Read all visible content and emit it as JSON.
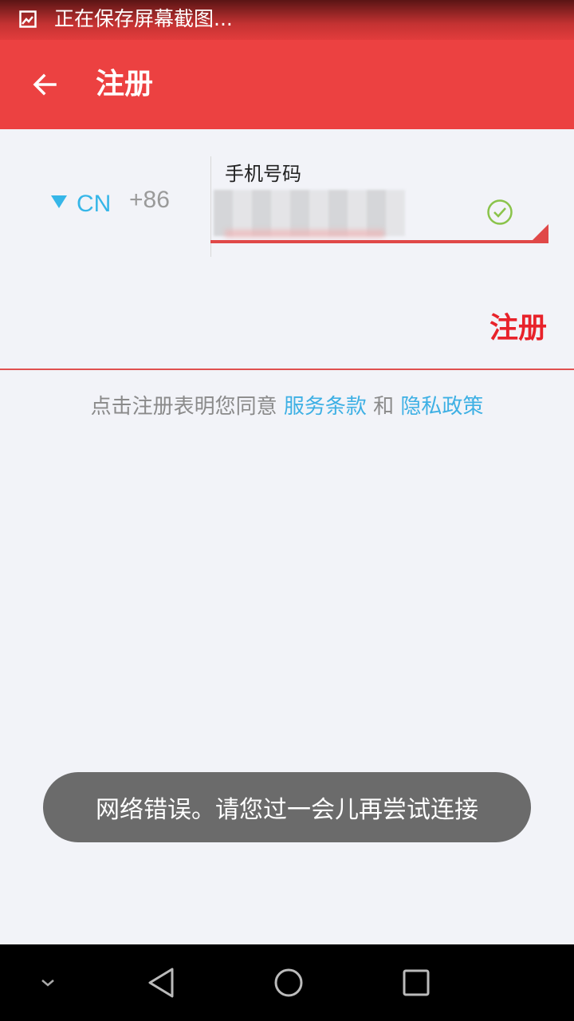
{
  "status_bar": {
    "notification_text": "正在保存屏幕截图..."
  },
  "app_bar": {
    "title": "注册"
  },
  "form": {
    "country_code": "CN",
    "dial_code": "+86",
    "phone_label": "手机号码",
    "phone_value": ""
  },
  "actions": {
    "register_label": "注册"
  },
  "agreement": {
    "prefix": "点击注册表明您同意",
    "terms_link": "服务条款",
    "conjunction": "和",
    "privacy_link": "隐私政策"
  },
  "toast": {
    "message": "网络错误。请您过一会儿再尝试连接"
  },
  "colors": {
    "primary": "#ec4141",
    "link": "#3eb0e4",
    "accent_text": "#e8222a",
    "check": "#8ac34a"
  },
  "icons": {
    "status": "screenshot-icon",
    "back": "arrow-left-icon",
    "country": "dropdown-triangle-icon",
    "valid": "check-circle-icon",
    "nav": [
      "chevron-down-icon",
      "back-triangle-icon",
      "home-circle-icon",
      "recents-square-icon"
    ]
  }
}
